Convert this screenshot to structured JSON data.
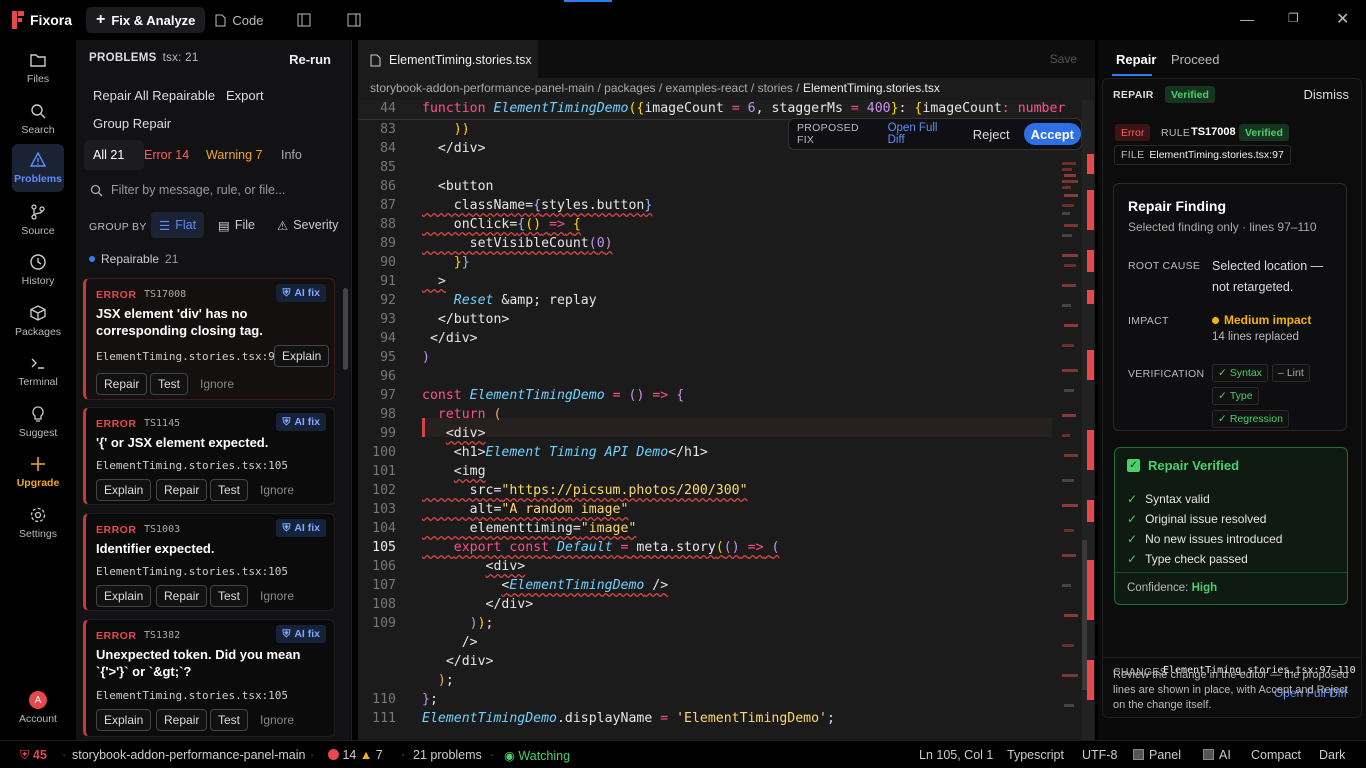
{
  "titlebar": {
    "app_name": "Fixora",
    "tab_fix": "Fix & Analyze",
    "tab_code": "Code"
  },
  "activity": [
    {
      "label": "Files",
      "icon": "folder-icon"
    },
    {
      "label": "Search",
      "icon": "search-icon"
    },
    {
      "label": "Problems",
      "icon": "warning-icon",
      "active": true
    },
    {
      "label": "Source",
      "icon": "git-branch-icon"
    },
    {
      "label": "History",
      "icon": "clock-icon"
    },
    {
      "label": "Packages",
      "icon": "package-icon"
    },
    {
      "label": "Terminal",
      "icon": "terminal-icon"
    },
    {
      "label": "Suggest",
      "icon": "lightbulb-icon"
    },
    {
      "label": "Upgrade",
      "icon": "sparkle-icon"
    },
    {
      "label": "Settings",
      "icon": "gear-icon"
    },
    {
      "label": "Account",
      "icon": "avatar",
      "initial": "A"
    }
  ],
  "problems": {
    "title": "PROBLEMS",
    "subtitle": "tsx: 21",
    "rerun": "Re-run",
    "repair_all": "Repair All Repairable",
    "export": "Export",
    "group_repair": "Group Repair",
    "filters": {
      "all": "All 21",
      "error": "Error 14",
      "warning": "Warning 7",
      "info": "Info"
    },
    "search_placeholder": "Filter by message, rule, or file...",
    "group_by": "GROUP BY",
    "group_options": [
      "Flat",
      "File",
      "Severity"
    ],
    "repairable": "Repairable",
    "repairable_count": "21",
    "cards": [
      {
        "level": "ERROR",
        "code": "TS17008",
        "ai": "AI fix",
        "title": "JSX element 'div' has no corresponding closing tag.",
        "file": "ElementTiming.stories.tsx:99",
        "buttons": [
          "Explain",
          "Repair",
          "Test"
        ],
        "ignore": "Ignore"
      },
      {
        "level": "ERROR",
        "code": "TS1145",
        "ai": "AI fix",
        "title": "'{' or JSX element expected.",
        "file": "ElementTiming.stories.tsx:105",
        "buttons": [
          "Explain",
          "Repair",
          "Test"
        ],
        "ignore": "Ignore"
      },
      {
        "level": "ERROR",
        "code": "TS1003",
        "ai": "AI fix",
        "title": "Identifier expected.",
        "file": "ElementTiming.stories.tsx:105",
        "buttons": [
          "Explain",
          "Repair",
          "Test"
        ],
        "ignore": "Ignore"
      },
      {
        "level": "ERROR",
        "code": "TS1382",
        "ai": "AI fix",
        "title": "Unexpected token. Did you mean `{'>'}` or `&gt;`?",
        "file": "ElementTiming.stories.tsx:105",
        "buttons": [
          "Explain",
          "Repair",
          "Test"
        ],
        "ignore": "Ignore"
      }
    ]
  },
  "editor": {
    "tab": "ElementTiming.stories.tsx",
    "save": "Save",
    "breadcrumbs": [
      "storybook-addon-performance-panel-main",
      "packages",
      "examples-react",
      "stories",
      "ElementTiming.stories.tsx"
    ],
    "sticky_line": "44",
    "proposed_fix": {
      "label": "PROPOSED FIX",
      "open_diff": "Open Full Diff",
      "reject": "Reject",
      "accept": "Accept"
    },
    "line_numbers": [
      "83",
      "84",
      "85",
      "86",
      "87",
      "88",
      "89",
      "90",
      "91",
      "92",
      "93",
      "94",
      "95",
      "96",
      "97",
      "98",
      "99",
      "100",
      "101",
      "102",
      "103",
      "104",
      "105",
      "106",
      "107",
      "108",
      "109",
      "",
      "",
      "",
      "110",
      "111"
    ],
    "current_line": "105"
  },
  "repair": {
    "tab_repair": "Repair",
    "tab_proceed": "Proceed",
    "header": "REPAIR",
    "verified": "Verified",
    "dismiss": "Dismiss",
    "error_badge": "Error",
    "rule_label": "RULE",
    "rule": "TS17008",
    "file_label": "FILE",
    "file": "ElementTiming.stories.tsx:97",
    "finding_title": "Repair Finding",
    "finding_sub": "Selected finding only · lines 97–110",
    "root_cause_label": "ROOT CAUSE",
    "root_cause": "Selected location — not retargeted.",
    "impact_label": "IMPACT",
    "impact": "Medium impact",
    "impact_sub": "14 lines replaced",
    "verification_label": "VERIFICATION",
    "checks": {
      "syntax": "Syntax",
      "lint": "Lint",
      "type": "Type",
      "regression": "Regression"
    },
    "verified_title": "Repair Verified",
    "verified_items": [
      "Syntax valid",
      "Original issue resolved",
      "No new issues introduced",
      "Type check passed"
    ],
    "confidence_label": "Confidence:",
    "confidence": "High",
    "changes_label": "CHANGES",
    "changes_file": "ElementTiming.stories.tsx:97–110",
    "open_diff": "Open Full Diff",
    "note": "Review the change in the editor — the proposed lines are shown in place, with Accept and Reject on the change itself."
  },
  "status": {
    "count": "45",
    "project": "storybook-addon-performance-panel-main",
    "errors": "14",
    "warnings": "7",
    "problems": "21 problems",
    "watching": "Watching",
    "position": "Ln 105, Col 1",
    "language": "Typescript",
    "encoding": "UTF-8",
    "panel": "Panel",
    "ai": "AI",
    "compact": "Compact",
    "theme": "Dark"
  }
}
